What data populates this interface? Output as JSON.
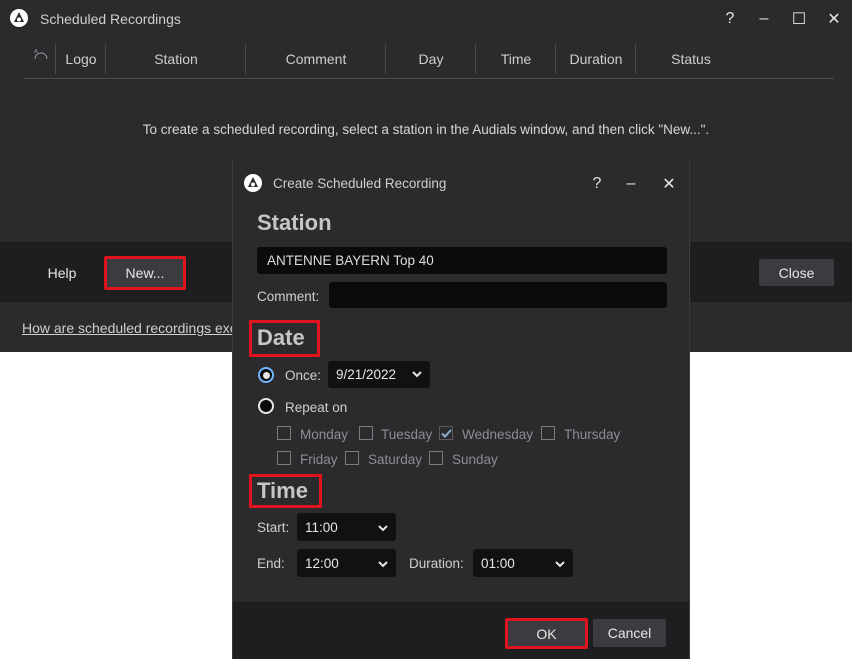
{
  "main": {
    "title": "Scheduled Recordings",
    "title_buttons": {
      "help": "?",
      "minimize": "–",
      "maximize": "☐",
      "close": "✕"
    },
    "columns": [
      "Logo",
      "Station",
      "Comment",
      "Day",
      "Time",
      "Duration",
      "Status"
    ],
    "info_text": "To create a scheduled recording, select a station in the Audials window, and then click \"New...\".",
    "help_button": "Help",
    "new_button": "New...",
    "close_button": "Close",
    "link_text": "How are scheduled recordings exe"
  },
  "dialog": {
    "title": "Create Scheduled Recording",
    "title_buttons": {
      "help": "?",
      "minimize": "–",
      "close": "✕"
    },
    "station_heading": "Station",
    "station_value": "ANTENNE BAYERN Top 40",
    "comment_label": "Comment:",
    "comment_value": "",
    "date_heading": "Date",
    "once_label": "Once:",
    "once_date": "9/21/2022",
    "repeat_label": "Repeat on",
    "days": [
      {
        "label": "Monday",
        "checked": false
      },
      {
        "label": "Tuesday",
        "checked": false
      },
      {
        "label": "Wednesday",
        "checked": true
      },
      {
        "label": "Thursday",
        "checked": false
      },
      {
        "label": "Friday",
        "checked": false
      },
      {
        "label": "Saturday",
        "checked": false
      },
      {
        "label": "Sunday",
        "checked": false
      }
    ],
    "time_heading": "Time",
    "start_label": "Start:",
    "start_value": "11:00",
    "end_label": "End:",
    "end_value": "12:00",
    "duration_label": "Duration:",
    "duration_value": "01:00",
    "ok_button": "OK",
    "cancel_button": "Cancel"
  },
  "colors": {
    "highlight": "#e0141e",
    "accent": "#6fb6ff",
    "background": "#2b2b2e"
  }
}
